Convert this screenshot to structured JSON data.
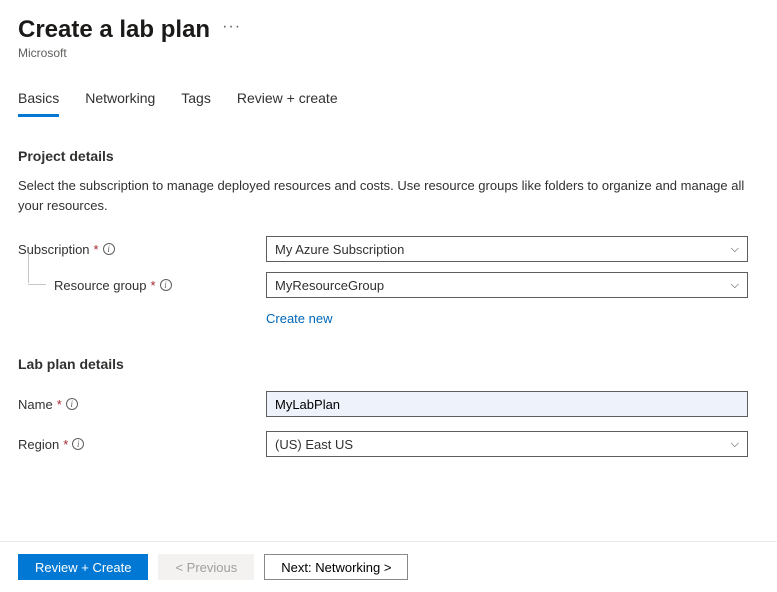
{
  "header": {
    "title": "Create a lab plan",
    "subtitle": "Microsoft"
  },
  "tabs": [
    {
      "label": "Basics",
      "active": true
    },
    {
      "label": "Networking",
      "active": false
    },
    {
      "label": "Tags",
      "active": false
    },
    {
      "label": "Review + create",
      "active": false
    }
  ],
  "sections": {
    "project": {
      "heading": "Project details",
      "description": "Select the subscription to manage deployed resources and costs. Use resource groups like folders to organize and manage all your resources.",
      "subscription": {
        "label": "Subscription",
        "value": "My Azure Subscription"
      },
      "resourceGroup": {
        "label": "Resource group",
        "value": "MyResourceGroup",
        "createNew": "Create new"
      }
    },
    "lab": {
      "heading": "Lab plan details",
      "name": {
        "label": "Name",
        "value": "MyLabPlan"
      },
      "region": {
        "label": "Region",
        "value": "(US) East US"
      }
    }
  },
  "footer": {
    "review": "Review + Create",
    "previous": "< Previous",
    "next": "Next: Networking >"
  }
}
